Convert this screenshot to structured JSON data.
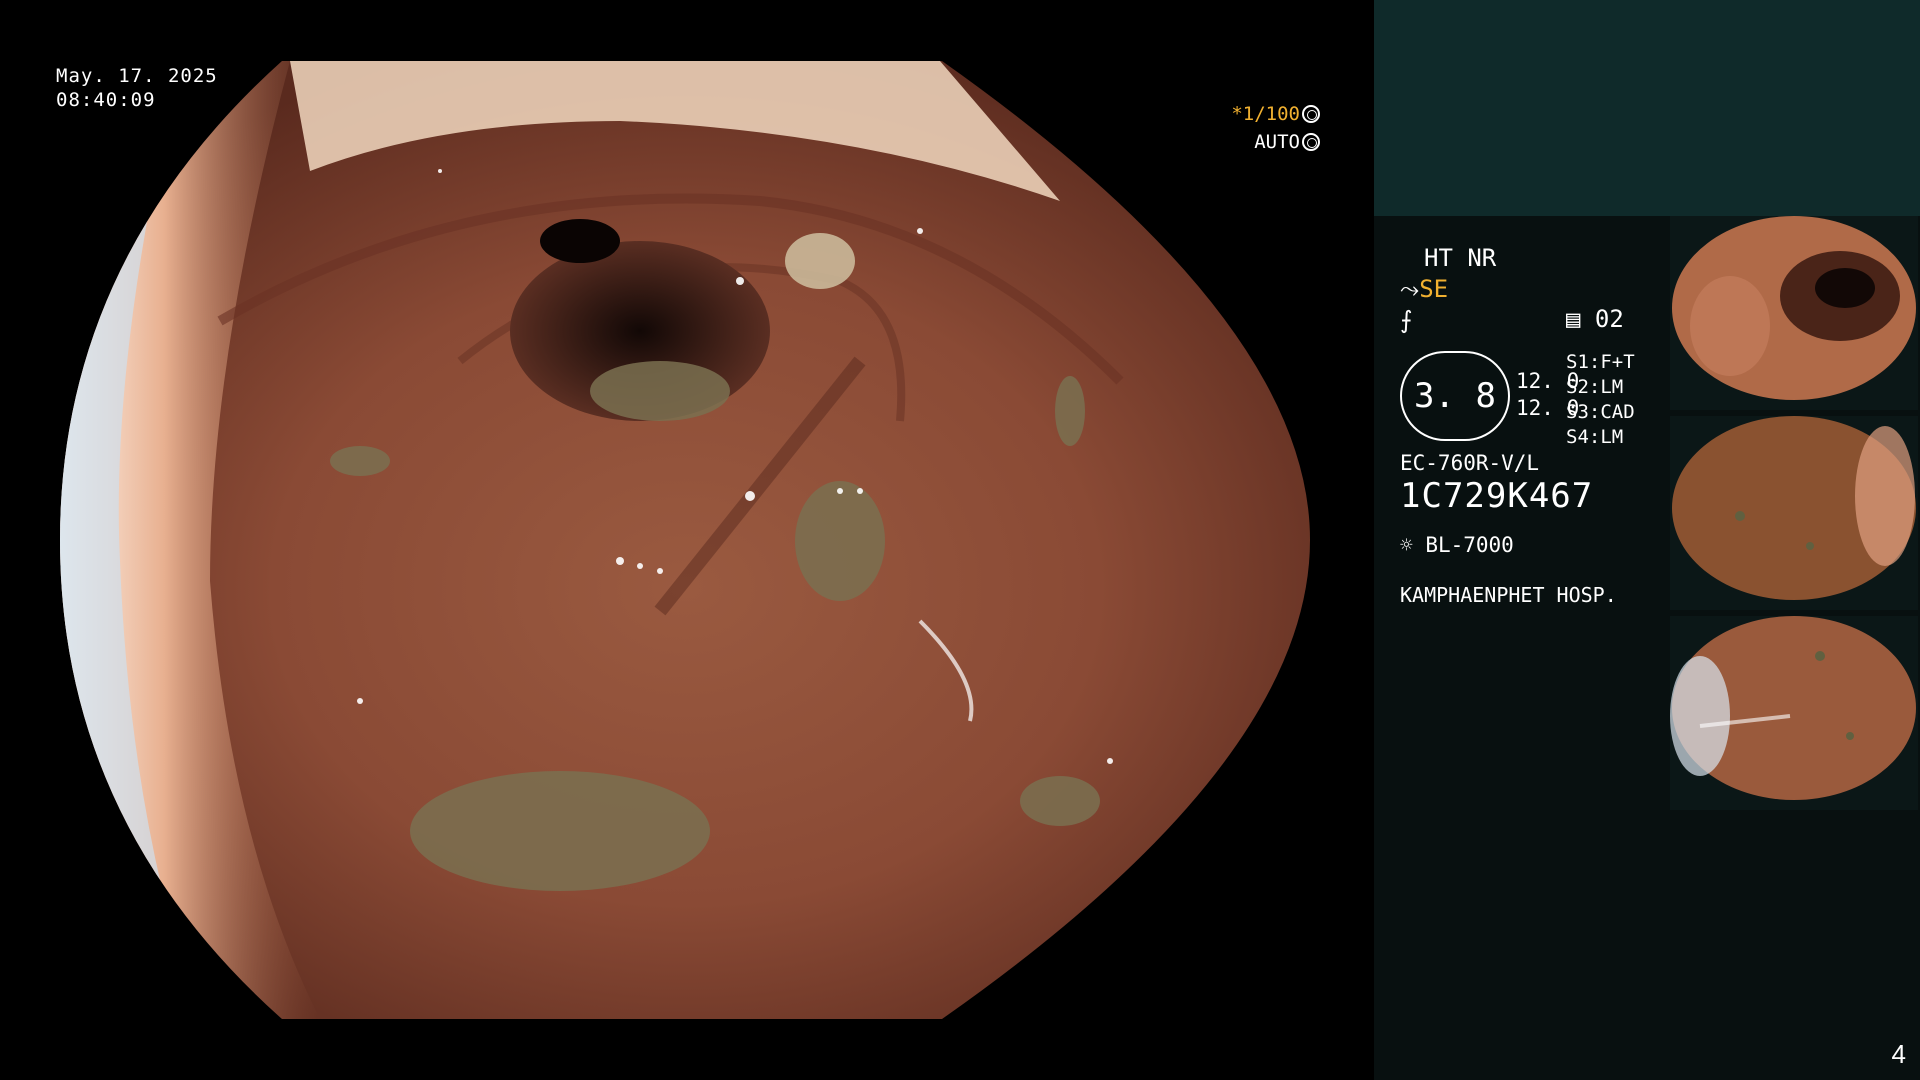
{
  "overlay": {
    "date": "May. 17. 2025",
    "time": "08:40:09",
    "shutter": "*1/100",
    "exposure_mode": "AUTO"
  },
  "panel": {
    "mode_line": "HT NR",
    "se_label": "SE",
    "channel_value": "02",
    "circle_value": "3. 8",
    "value_a": "12. 0",
    "value_b": "12. 0",
    "s1": "S1:F+T",
    "s2": "S2:LM",
    "s3": "S3:CAD",
    "s4": "S4:LM",
    "scope_model": "EC-760R-V/L",
    "serial": "1C729K467",
    "light_source": "BL-7000",
    "hospital": "KAMPHAENPHET HOSP."
  },
  "page_number": "4",
  "colors": {
    "accent": "#f0b030",
    "panel_bg": "#081010",
    "panel_top": "#0f2a2a"
  },
  "icons": [
    "scope-icon",
    "scope-tip-icon",
    "filter-icon",
    "lamp-icon",
    "exposure-icon"
  ]
}
